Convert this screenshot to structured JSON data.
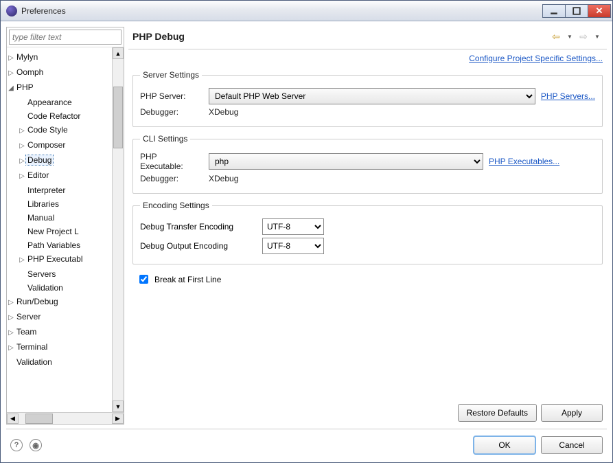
{
  "window": {
    "title": "Preferences"
  },
  "filter": {
    "placeholder": "type filter text"
  },
  "tree": {
    "mylyn": "Mylyn",
    "oomph": "Oomph",
    "php": "PHP",
    "appearance": "Appearance",
    "code_refactor": "Code Refactor",
    "code_style": "Code Style",
    "composer": "Composer",
    "debug": "Debug",
    "editor": "Editor",
    "interpreter": "Interpreter",
    "libraries": "Libraries",
    "manual": "Manual",
    "new_project_l": "New Project L",
    "path_variables": "Path Variables",
    "php_executabl": "PHP Executabl",
    "servers": "Servers",
    "validation": "Validation",
    "run_debug": "Run/Debug",
    "server": "Server",
    "team": "Team",
    "terminal": "Terminal",
    "validation2": "Validation"
  },
  "header": {
    "title": "PHP Debug"
  },
  "project_link": "Configure Project Specific Settings...",
  "server_settings": {
    "legend": "Server Settings",
    "php_server_label": "PHP Server:",
    "php_server_value": "Default PHP Web Server",
    "php_servers_link": "PHP Servers...",
    "debugger_label": "Debugger:",
    "debugger_value": "XDebug"
  },
  "cli_settings": {
    "legend": "CLI Settings",
    "php_exec_label_1": "PHP",
    "php_exec_label_2": "Executable:",
    "php_exec_value": "php",
    "php_exec_link": "PHP Executables...",
    "debugger_label": "Debugger:",
    "debugger_value": "XDebug"
  },
  "encoding_settings": {
    "legend": "Encoding Settings",
    "transfer_label": "Debug Transfer Encoding",
    "transfer_value": "UTF-8",
    "output_label": "Debug Output Encoding",
    "output_value": "UTF-8"
  },
  "break_first_line": {
    "label": "Break at First Line",
    "checked": true
  },
  "buttons": {
    "restore": "Restore Defaults",
    "apply": "Apply",
    "ok": "OK",
    "cancel": "Cancel"
  }
}
